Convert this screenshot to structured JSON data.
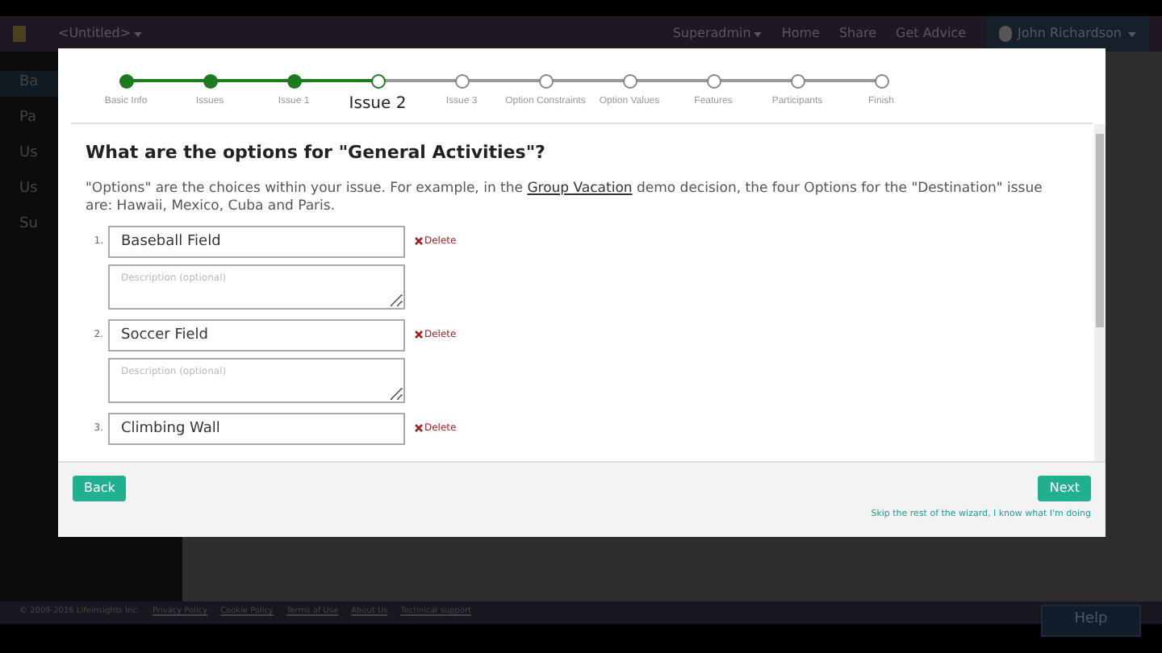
{
  "navbar": {
    "document": "<Untitled>",
    "items": [
      "Superadmin",
      "Home",
      "Share",
      "Get Advice"
    ],
    "user": "John Richardson"
  },
  "sidebar": {
    "items": [
      {
        "label": "Ba",
        "selected": true
      },
      {
        "label": "Pa",
        "selected": false
      },
      {
        "label": "Us",
        "selected": false
      },
      {
        "label": "Us",
        "selected": false
      },
      {
        "label": "Su",
        "selected": false
      }
    ]
  },
  "wizard": {
    "steps": [
      {
        "label": "Basic Info",
        "done": true,
        "selected": false
      },
      {
        "label": "Issues",
        "done": true,
        "selected": false
      },
      {
        "label": "Issue 1",
        "done": true,
        "selected": false
      },
      {
        "label": "Issue 2",
        "done": false,
        "selected": true
      },
      {
        "label": "Issue 3",
        "done": false,
        "selected": false
      },
      {
        "label": "Option Constraints",
        "done": false,
        "selected": false
      },
      {
        "label": "Option Values",
        "done": false,
        "selected": false
      },
      {
        "label": "Features",
        "done": false,
        "selected": false
      },
      {
        "label": "Participants",
        "done": false,
        "selected": false
      },
      {
        "label": "Finish",
        "done": false,
        "selected": false
      }
    ],
    "heading": "What are the options for \"General Activities\"?",
    "intro_before": "\"Options\" are the choices within your issue. For example, in the",
    "intro_link": "Group Vacation",
    "intro_after": "demo decision, the four Options for the \"Destination\" issue are: Hawaii, Mexico, Cuba and Paris.",
    "options": [
      {
        "number": "1.",
        "value": "Baseball Field",
        "delete": "Delete",
        "description_placeholder": "Description (optional)"
      },
      {
        "number": "2.",
        "value": "Soccer Field",
        "delete": "Delete",
        "description_placeholder": "Description (optional)"
      },
      {
        "number": "3.",
        "value": "Climbing Wall",
        "delete": "Delete"
      }
    ],
    "back": "Back",
    "next": "Next",
    "skip": "Skip the rest of the wizard, I know what I'm doing"
  },
  "footer": {
    "copyright": "© 2009-2016 Lifeinsights Inc.",
    "links": [
      "Privacy Policy",
      "Cookie Policy",
      "Terms of Use",
      "About Us",
      "Technical support"
    ]
  },
  "help": "Help"
}
